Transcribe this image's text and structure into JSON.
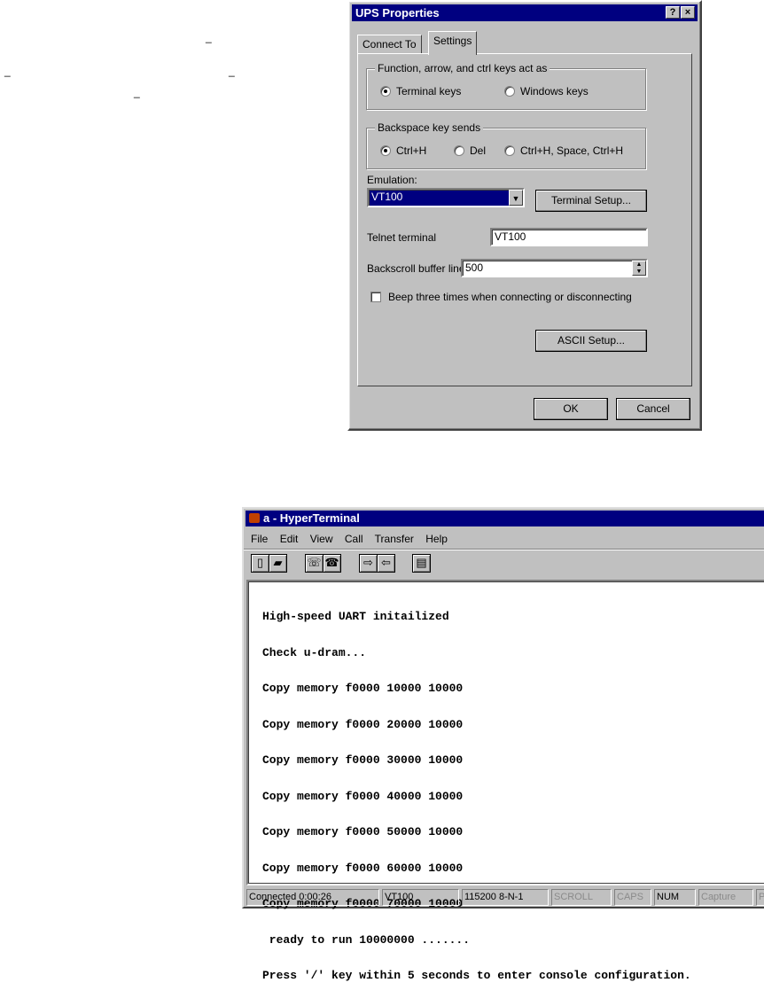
{
  "doc_fragment": {
    "underscores": [
      "_",
      "_",
      "_",
      "_"
    ]
  },
  "ups_dialog": {
    "title": "UPS Properties",
    "help_glyph": "?",
    "close_glyph": "×",
    "tabs": [
      "Connect To",
      "Settings"
    ],
    "active_tab": "Settings",
    "fn_keys_group": {
      "legend": "Function, arrow, and ctrl keys act as",
      "options": [
        "Terminal keys",
        "Windows keys"
      ],
      "selected": "Terminal keys"
    },
    "backspace_group": {
      "legend": "Backspace key sends",
      "options": [
        "Ctrl+H",
        "Del",
        "Ctrl+H, Space, Ctrl+H"
      ],
      "selected": "Ctrl+H"
    },
    "emulation_label": "Emulation:",
    "emulation_value": "VT100",
    "terminal_setup_button": "Terminal Setup...",
    "telnet_label": "Telnet terminal",
    "telnet_value": "VT100",
    "backscroll_label": "Backscroll buffer lines:",
    "backscroll_value": "500",
    "beep_label": "Beep three times when connecting or disconnecting",
    "beep_checked": false,
    "ascii_setup_button": "ASCII Setup...",
    "ok_button": "OK",
    "cancel_button": "Cancel"
  },
  "hyperterminal": {
    "title": "a - HyperTerminal",
    "menu": [
      "File",
      "Edit",
      "View",
      "Call",
      "Transfer",
      "Help"
    ],
    "toolbar_icons": [
      "new-icon",
      "open-icon",
      "connect-icon",
      "disconnect-icon",
      "send-icon",
      "receive-icon",
      "properties-icon"
    ],
    "terminal_lines": [
      "High-speed UART initailized",
      "Check u-dram...",
      "Copy memory f0000 10000 10000",
      "Copy memory f0000 20000 10000",
      "Copy memory f0000 30000 10000",
      "Copy memory f0000 40000 10000",
      "Copy memory f0000 50000 10000",
      "Copy memory f0000 60000 10000",
      "Copy memory f0000 70000 10000",
      " ready to run 10000000 .......",
      "Press '/' key within 5 seconds to enter console configuration."
    ],
    "status": {
      "connected": "Connected 0:00:26",
      "emulation": "VT100",
      "port": "115200 8-N-1",
      "scroll": "SCROLL",
      "caps": "CAPS",
      "num": "NUM",
      "capture": "Capture",
      "print": "P"
    }
  }
}
